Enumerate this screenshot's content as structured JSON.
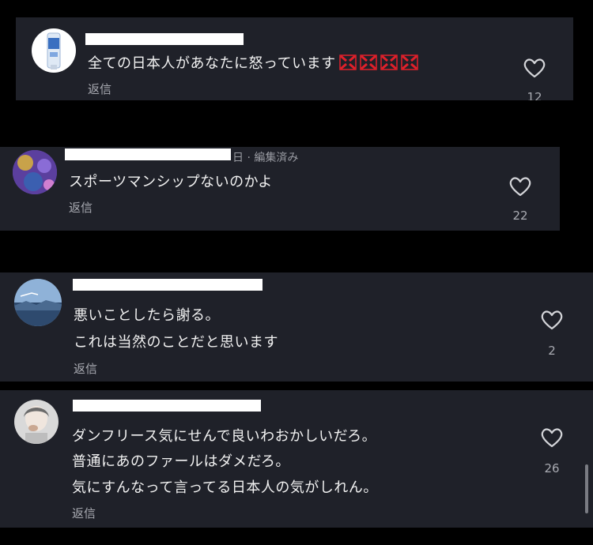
{
  "comments": [
    {
      "avatar_icon": "toothpaste-tube-avatar",
      "meta": "",
      "lines": [
        "全ての日本人があなたに怒っています"
      ],
      "emoji_count": 4,
      "emoji_icon": "anger-symbol-icon",
      "reply_label": "返信",
      "likes": "12"
    },
    {
      "avatar_icon": "purple-pattern-avatar",
      "meta": "日 · 編集済み",
      "lines": [
        "スポーツマンシップないのかよ"
      ],
      "reply_label": "返信",
      "likes": "22"
    },
    {
      "avatar_icon": "sky-landscape-avatar",
      "meta": "",
      "lines": [
        "悪いことしたら謝る。",
        "これは当然のことだと思います"
      ],
      "reply_label": "返信",
      "likes": "2"
    },
    {
      "avatar_icon": "person-photo-avatar",
      "meta": "",
      "lines": [
        "ダンフリース気にせんで良いわおかしいだろ。",
        "普通にあのファールはダメだろ。",
        "気にすんなって言ってる日本人の気がしれん。"
      ],
      "reply_label": "返信",
      "likes": "26"
    }
  ],
  "colors": {
    "background": "#000000",
    "card": "#1f2129",
    "text": "#f2f2f2",
    "muted": "#a9abb2",
    "anger_red": "#e0202a"
  }
}
